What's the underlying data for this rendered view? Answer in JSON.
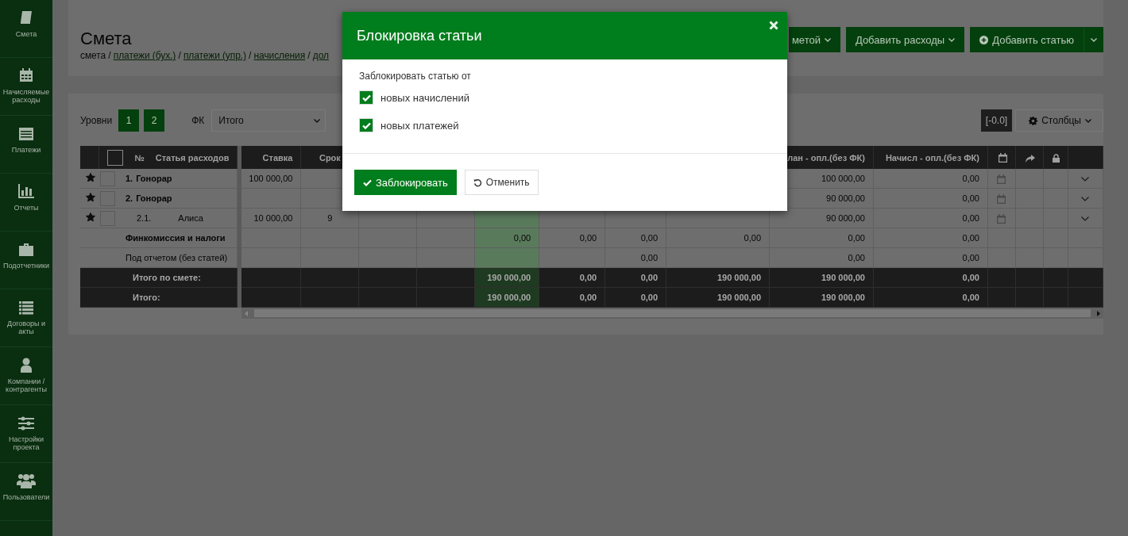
{
  "sidebar": {
    "items": [
      {
        "kind": "book",
        "label": "Смета"
      },
      {
        "kind": "calendar",
        "label": "Начисляемые расходы"
      },
      {
        "kind": "payments",
        "label": "Платежи"
      },
      {
        "kind": "chart",
        "label": "Отчеты"
      },
      {
        "kind": "briefcase",
        "label": "Подотчетники"
      },
      {
        "kind": "list",
        "label": "Договоры и акты"
      },
      {
        "kind": "person",
        "label": "Компании / контрагенты"
      },
      {
        "kind": "sliders",
        "label": "Настройки проекта"
      },
      {
        "kind": "users",
        "label": "Пользователи"
      }
    ]
  },
  "header": {
    "title": "Смета",
    "separator": "/",
    "breadcrumb": [
      {
        "label": "смета",
        "link": false
      },
      {
        "label": "платежи (бух.)",
        "link": true
      },
      {
        "label": "платежи (упр.)",
        "link": true
      },
      {
        "label": "начисления",
        "link": true
      },
      {
        "label": "дол",
        "link": true
      }
    ],
    "buttons": [
      {
        "label": "метой",
        "caret": true,
        "plus": false,
        "split": false
      },
      {
        "label": "Добавить расходы",
        "caret": true,
        "plus": false,
        "split": false
      },
      {
        "label": "Добавить статью",
        "caret": false,
        "plus": true,
        "split": true
      }
    ]
  },
  "toolbar": {
    "levels_label": "Уровни",
    "levels": [
      "1",
      "2"
    ],
    "fk_label": "ФК",
    "fk_value": "Итого",
    "precision": "[-0.0]",
    "columns_button": "Столбцы"
  },
  "table": {
    "header_checkbox": {
      "checked": false
    },
    "number_heading": "№",
    "name_heading": "Статья расходов",
    "columns": [
      {
        "kind": "text",
        "label": "Ставка",
        "highlighted": false
      },
      {
        "kind": "text",
        "label": "Срок",
        "highlighted": false
      },
      {
        "kind": "covered",
        "highlighted": false
      },
      {
        "kind": "covered",
        "highlighted": false
      },
      {
        "kind": "covered",
        "highlighted": true
      },
      {
        "kind": "covered",
        "highlighted": false
      },
      {
        "kind": "covered",
        "highlighted": false
      },
      {
        "kind": "covered",
        "highlighted": false
      },
      {
        "kind": "text",
        "label": "лан - опл.(без ФК)",
        "highlighted": false
      },
      {
        "kind": "text",
        "label": "Начисл - опл.(без ФК)",
        "highlighted": false
      },
      {
        "kind": "calendar",
        "highlighted": false
      },
      {
        "kind": "share",
        "highlighted": false
      },
      {
        "kind": "lock",
        "highlighted": false
      },
      {
        "kind": "blank",
        "highlighted": false
      }
    ],
    "rows": [
      {
        "number": "1.",
        "name": "Гонорар",
        "starred": true,
        "checked": false,
        "calendar": true,
        "expandable": true,
        "cells": [
          "100 000,00",
          null,
          null,
          null,
          null,
          null,
          null,
          null,
          "100 000,00",
          "0,00"
        ]
      },
      {
        "number": "2.",
        "name": "Гонорар",
        "starred": true,
        "checked": false,
        "calendar": true,
        "expandable": true,
        "cells": [
          null,
          null,
          null,
          null,
          null,
          null,
          null,
          null,
          "90 000,00",
          "0,00"
        ],
        "children": [
          {
            "number": "2.1.",
            "name": "Алиса",
            "starred": true,
            "checked": false,
            "calendar": true,
            "expandable": true,
            "cells": [
              "10 000,00",
              "9",
              null,
              null,
              null,
              null,
              null,
              null,
              "90 000,00",
              "0,00"
            ]
          }
        ]
      }
    ],
    "summary_rows": [
      {
        "kind": "section",
        "name": "Финкомиссия и налоги",
        "cells": [
          null,
          null,
          null,
          null,
          "0,00",
          "0,00",
          "0,00",
          "0,00",
          "0,00",
          "0,00"
        ]
      },
      {
        "kind": "plain",
        "name": "Под отчетом (без статей)",
        "cells": [
          null,
          null,
          null,
          null,
          null,
          null,
          "0,00",
          null,
          "0,00",
          "0,00"
        ]
      },
      {
        "kind": "total",
        "name": "Итого по смете:",
        "cells": [
          null,
          null,
          null,
          null,
          "190 000,00",
          "0,00",
          "0,00",
          "190 000,00",
          "190 000,00",
          "0,00"
        ]
      },
      {
        "kind": "total",
        "name": "Итого:",
        "cells": [
          null,
          null,
          null,
          null,
          "190 000,00",
          "0,00",
          "0,00",
          "190 000,00",
          "190 000,00",
          "0,00"
        ]
      }
    ]
  },
  "dialog": {
    "title": "Блокировка статьи",
    "prompt": "Заблокировать статью от",
    "options": [
      {
        "label": "новых начислений",
        "checked": true
      },
      {
        "label": "новых платежей",
        "checked": true
      }
    ],
    "confirm": "Заблокировать",
    "cancel": "Отменить"
  }
}
